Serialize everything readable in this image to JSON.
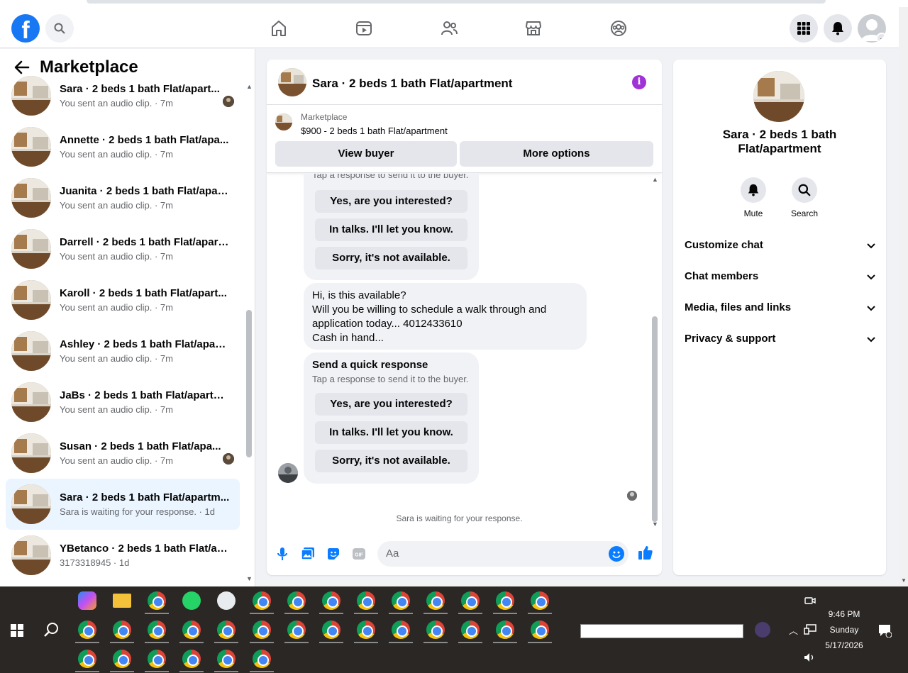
{
  "header": {
    "logo": "f",
    "icons": [
      "search-icon",
      "home-icon",
      "video-icon",
      "friends-icon",
      "marketplace-icon",
      "groups-icon",
      "menu-grid-icon",
      "bell-icon",
      "profile-avatar"
    ]
  },
  "sidebar": {
    "title": "Marketplace",
    "conversations": [
      {
        "name": "Sara · 2 beds 1 bath Flat/apart...",
        "sub": "You sent an audio clip. · 7m",
        "seen": true,
        "active": false
      },
      {
        "name": "Annette · 2 beds 1 bath Flat/apa...",
        "sub": "You sent an audio clip. · 7m",
        "seen": false,
        "active": false
      },
      {
        "name": "Juanita · 2 beds 1 bath Flat/apar...",
        "sub": "You sent an audio clip. · 7m",
        "seen": false,
        "active": false
      },
      {
        "name": "Darrell · 2 beds 1 bath Flat/apart...",
        "sub": "You sent an audio clip. · 7m",
        "seen": false,
        "active": false
      },
      {
        "name": "Karoll · 2 beds 1 bath Flat/apart...",
        "sub": "You sent an audio clip. · 7m",
        "seen": false,
        "active": false
      },
      {
        "name": "Ashley · 2 beds 1 bath Flat/apart...",
        "sub": "You sent an audio clip. · 7m",
        "seen": false,
        "active": false
      },
      {
        "name": "JaBs · 2 beds 1 bath Flat/apartm...",
        "sub": "You sent an audio clip. · 7m",
        "seen": false,
        "active": false
      },
      {
        "name": "Susan · 2 beds 1 bath Flat/apa...",
        "sub": "You sent an audio clip. · 7m",
        "seen": true,
        "active": false
      },
      {
        "name": "Sara · 2 beds 1 bath Flat/apartm...",
        "sub": "Sara is waiting for your response. · 1d",
        "seen": false,
        "active": true
      },
      {
        "name": "YBetanco · 2 beds 1 bath Flat/ap...",
        "sub": "3173318945 · 1d",
        "seen": false,
        "active": false
      }
    ]
  },
  "chat": {
    "title": "Sara · 2 beds 1 bath Flat/apartment",
    "listing_label": "Marketplace",
    "listing_price": "$900 - 2 beds 1 bath Flat/apartment",
    "view_buyer": "View buyer",
    "more_options": "More options",
    "quick_response_title": "Send a quick response",
    "quick_response_sub": "Tap a response to send it to the buyer.",
    "quick_replies": [
      "Yes, are you interested?",
      "In talks. I'll let you know.",
      "Sorry, it's not available."
    ],
    "buyer_message": [
      "Hi, is this available?",
      "Will you be willing to schedule a walk through and",
      "application today... 4012433610",
      "Cash in hand..."
    ],
    "waiting": "Sara is waiting for your response.",
    "composer_placeholder": "Aa"
  },
  "info": {
    "name": "Sara · 2 beds 1 bath Flat/apartment",
    "mute": "Mute",
    "search": "Search",
    "sections": [
      "Customize chat",
      "Chat members",
      "Media, files and links",
      "Privacy & support"
    ]
  },
  "taskbar": {
    "time": "9:46 PM",
    "day": "Sunday",
    "date": "5/17/2026"
  }
}
